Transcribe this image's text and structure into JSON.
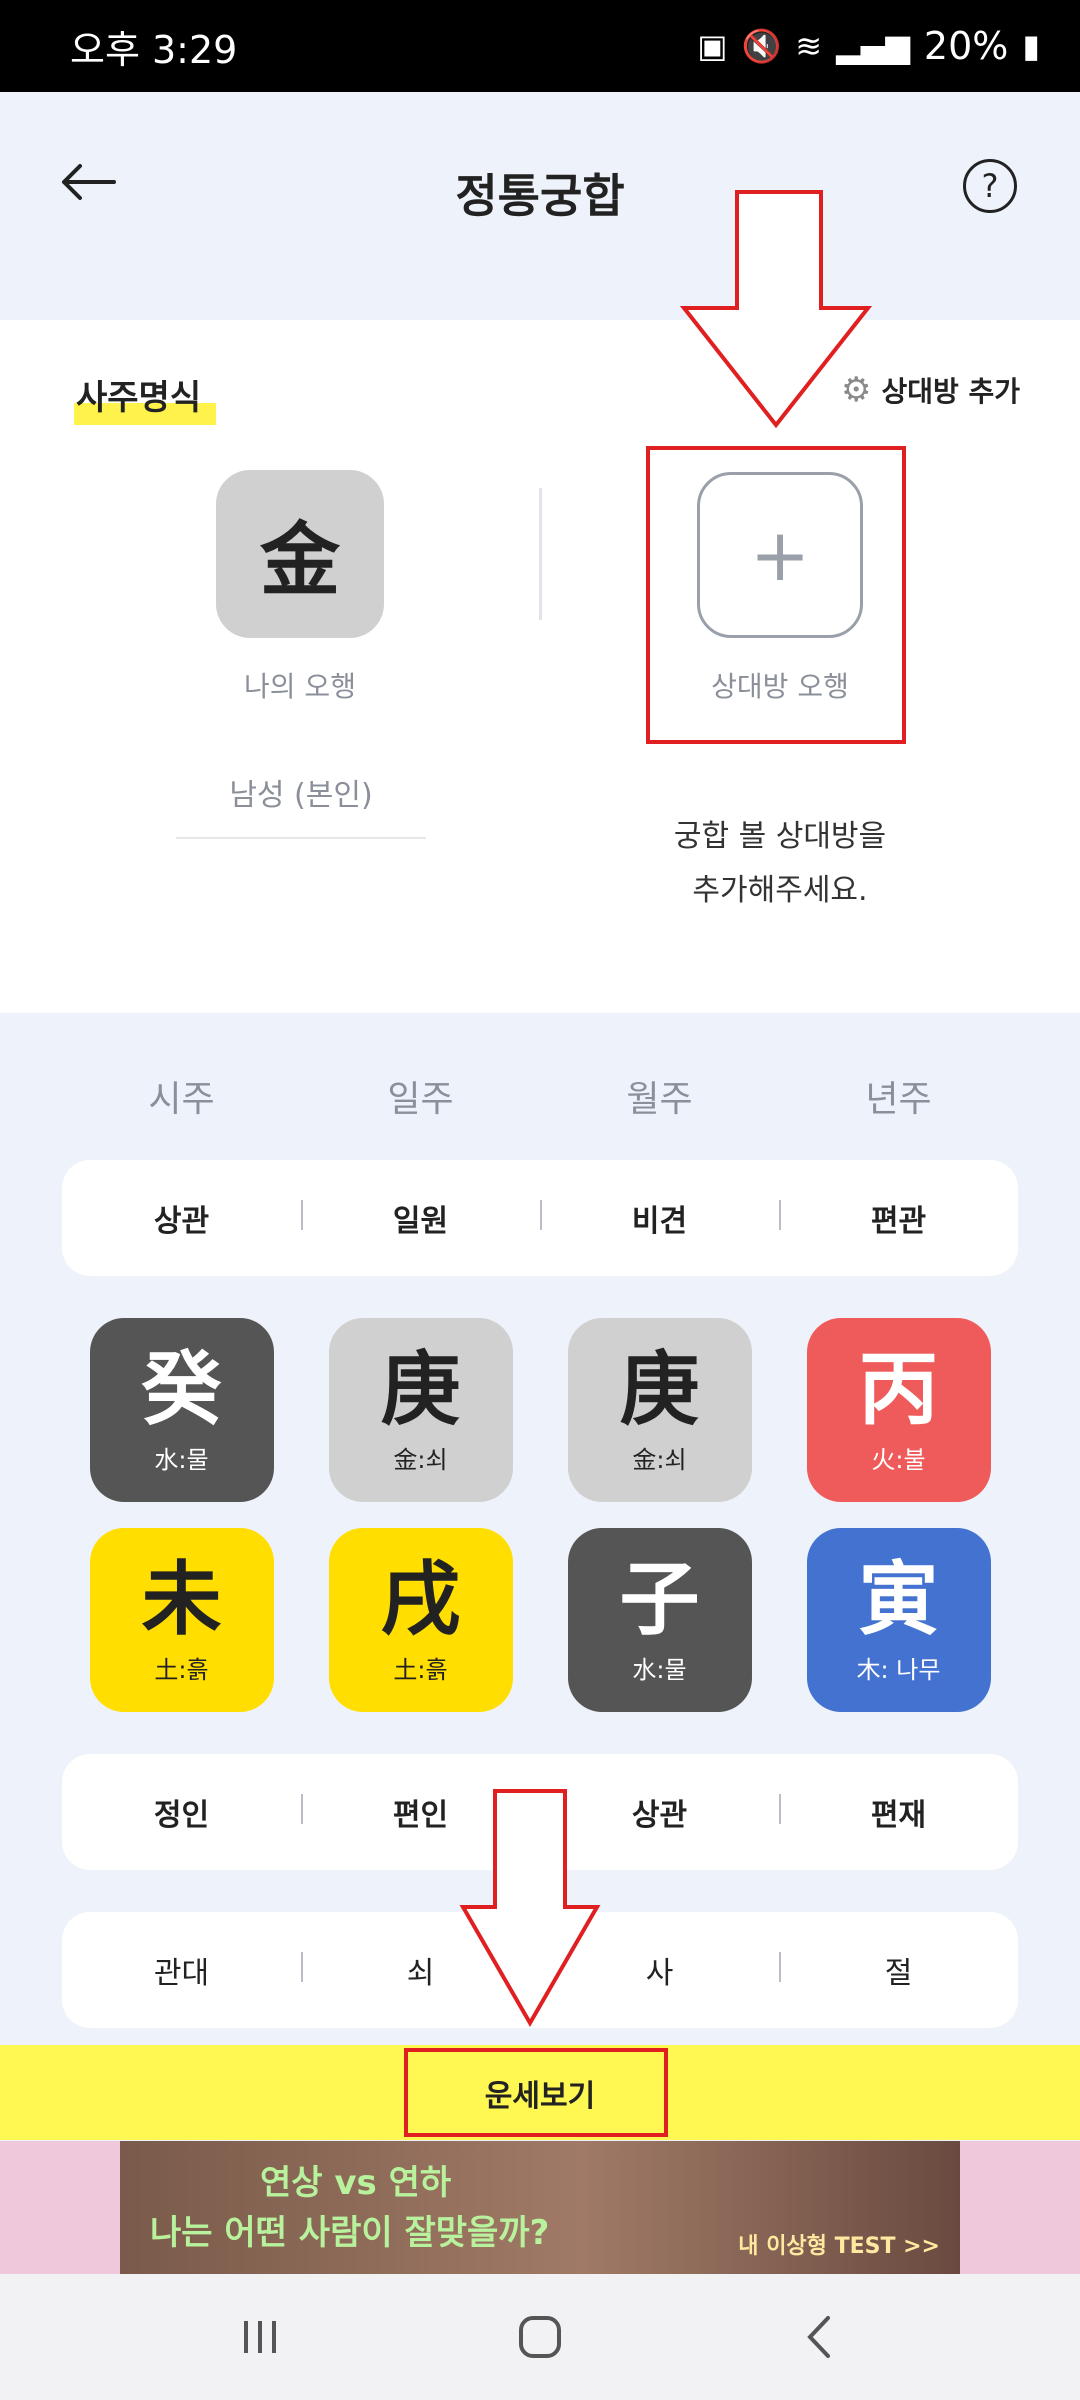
{
  "status": {
    "time": "오후 3:29",
    "battery": "20%"
  },
  "header": {
    "title": "정통궁합",
    "back_icon": "arrow-left-icon",
    "help": "?"
  },
  "saju": {
    "section_title": "사주명식",
    "add_partner_label": "상대방 추가",
    "my_element": "金",
    "my_label": "나의 오행",
    "partner_label": "상대방 오행",
    "gender": "남성 (본인)",
    "prompt_line1": "궁합 볼 상대방을",
    "prompt_line2": "추가해주세요."
  },
  "pillars": {
    "headers": [
      "시주",
      "일주",
      "월주",
      "년주"
    ],
    "top_gods": [
      "상관",
      "일원",
      "비견",
      "편관"
    ],
    "stems": [
      {
        "char": "癸",
        "sub": "水:물",
        "bg": "#555555",
        "fg": "#ffffff"
      },
      {
        "char": "庚",
        "sub": "金:쇠",
        "bg": "#d0d0d0",
        "fg": "#222222"
      },
      {
        "char": "庚",
        "sub": "金:쇠",
        "bg": "#d0d0d0",
        "fg": "#222222"
      },
      {
        "char": "丙",
        "sub": "火:불",
        "bg": "#ef5b5b",
        "fg": "#ffffff"
      }
    ],
    "branches": [
      {
        "char": "未",
        "sub": "土:흙",
        "bg": "#ffde00",
        "fg": "#222222"
      },
      {
        "char": "戌",
        "sub": "土:흙",
        "bg": "#ffde00",
        "fg": "#222222"
      },
      {
        "char": "子",
        "sub": "水:물",
        "bg": "#555555",
        "fg": "#ffffff"
      },
      {
        "char": "寅",
        "sub": "木: 나무",
        "bg": "#4472d0",
        "fg": "#ffffff"
      }
    ],
    "bottom_gods": [
      "정인",
      "편인",
      "상관",
      "편재"
    ],
    "life_stages": [
      "관대",
      "쇠",
      "사",
      "절"
    ]
  },
  "fortune_button": "운세보기",
  "ad": {
    "line1": "연상 vs 연하",
    "line2": "나는 어떤 사람이 잘맞을까?",
    "cta": "내 이상형 TEST >>"
  },
  "colors": {
    "highlight": "#fff24a",
    "fortune_bar": "#fff852",
    "annotation_red": "#e02020"
  }
}
